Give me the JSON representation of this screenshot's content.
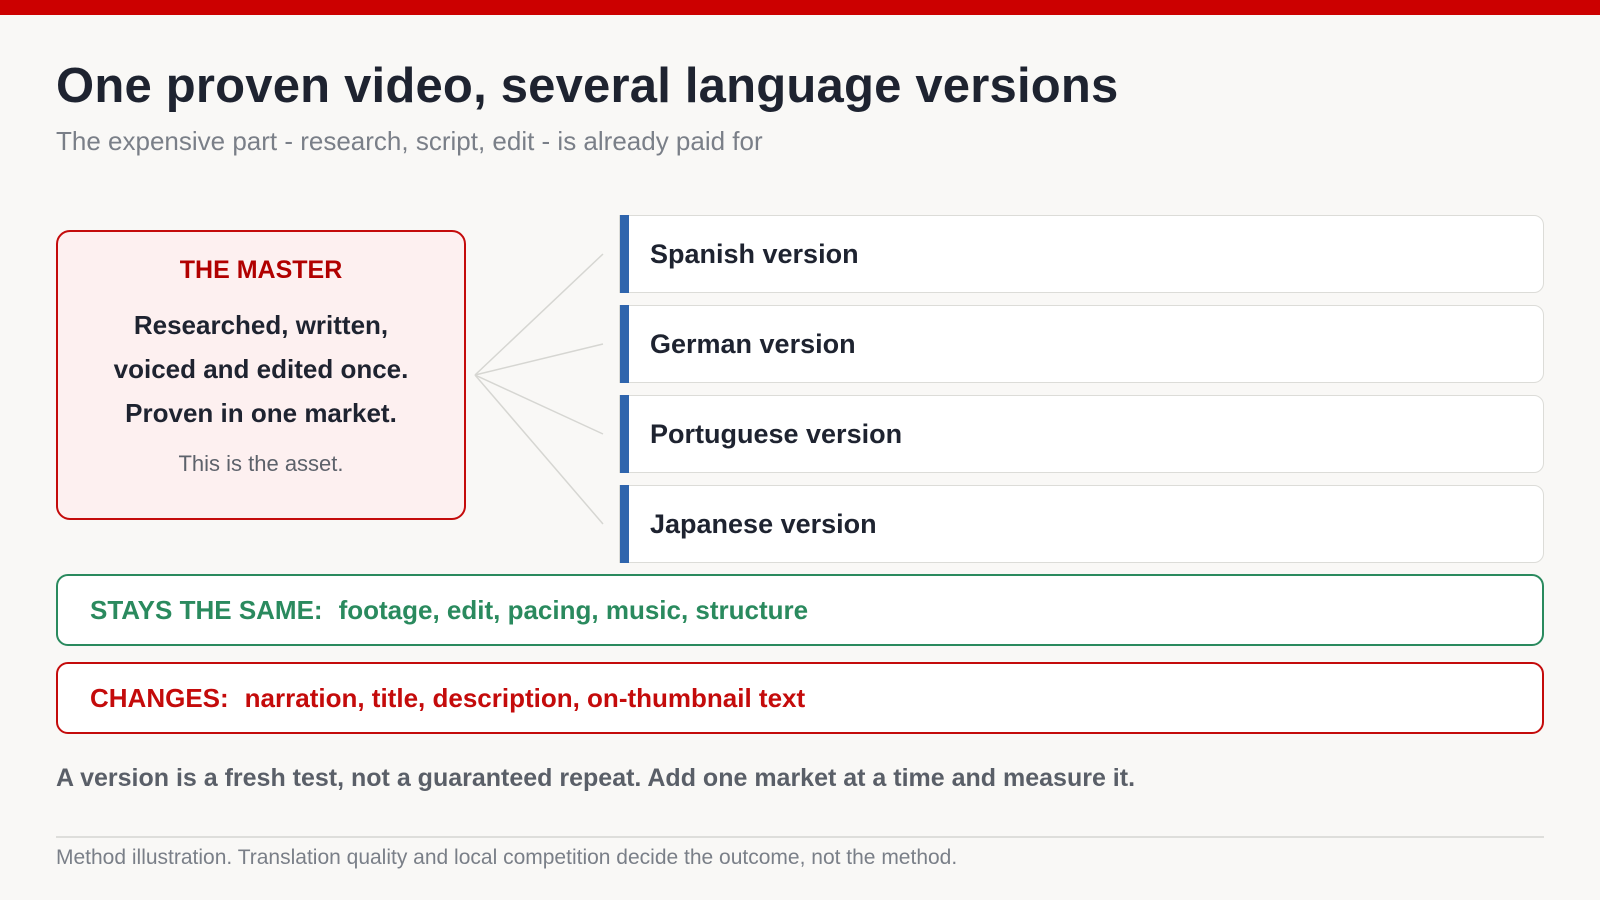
{
  "title": "One proven video, several language versions",
  "subtitle": "The expensive part - research, script, edit - is already paid for",
  "master": {
    "heading": "THE MASTER",
    "body_lines": [
      "Researched, written,",
      "voiced and edited once.",
      "Proven in one market."
    ],
    "note": "This is the asset."
  },
  "versions": [
    {
      "label": "Spanish version"
    },
    {
      "label": "German version"
    },
    {
      "label": "Portuguese version"
    },
    {
      "label": "Japanese version"
    }
  ],
  "stays_same": {
    "label": "STAYS THE SAME:",
    "items": "footage, edit, pacing, music, structure"
  },
  "changes": {
    "label": "CHANGES:",
    "items": "narration, title, description, on-thumbnail text"
  },
  "takeaway": "A version is a fresh test, not a guaranteed repeat. Add one market at a time and measure it.",
  "footnote": "Method illustration. Translation quality and local competition decide the outcome, not the method.",
  "colors": {
    "accent_red": "#cc0000",
    "version_bar_blue": "#2f65ad",
    "stays_green": "#2a8a5e",
    "changes_red": "#c40b0b"
  }
}
